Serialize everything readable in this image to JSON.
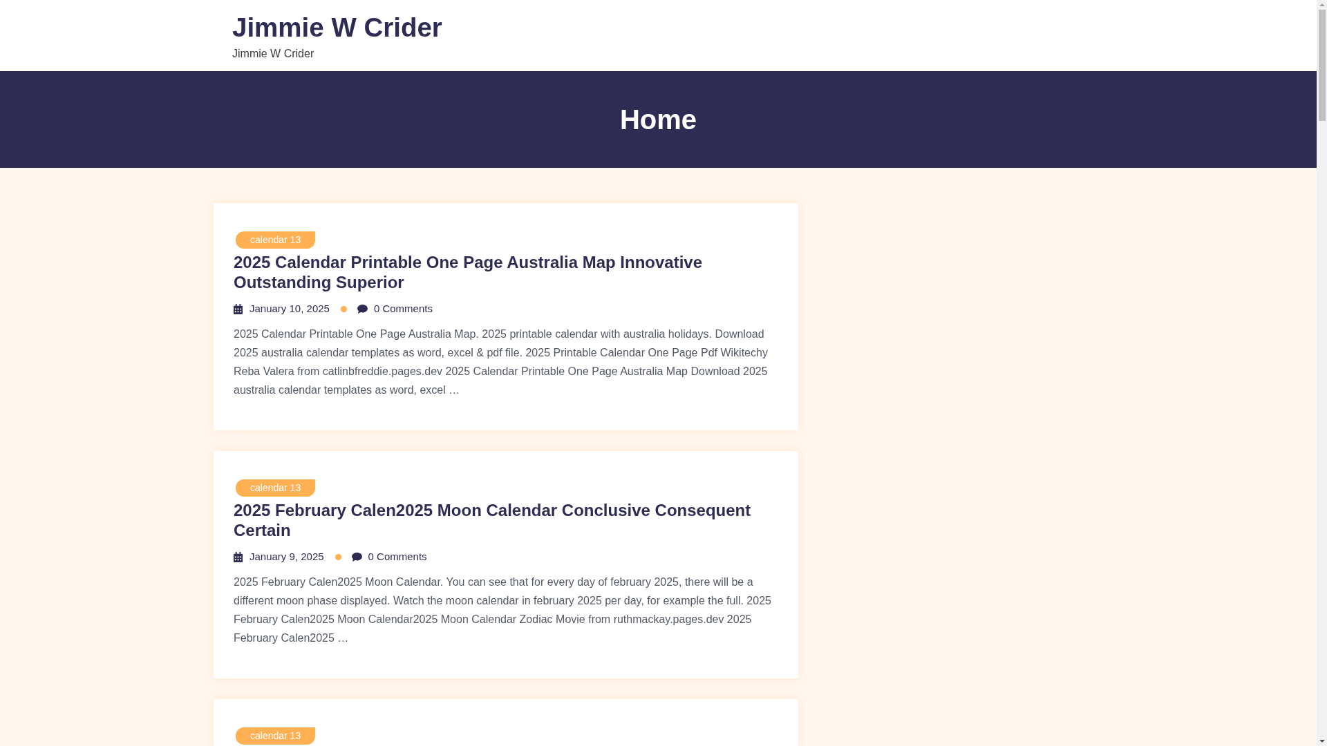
{
  "site": {
    "title": "Jimmie W Crider",
    "tagline": "Jimmie W Crider"
  },
  "page_title": "Home",
  "posts": [
    {
      "category": "calendar 13",
      "title": "2025 Calendar Printable One Page Australia Map Innovative Outstanding Superior",
      "date": "January 10, 2025",
      "comments": "0 Comments",
      "excerpt": "2025 Calendar Printable One Page Australia Map. 2025 printable calendar with australia holidays. Download 2025 australia calendar templates as word, excel & pdf file. 2025 Printable Calendar One Page Pdf Wikitechy Reba Valera from catlinbfreddie.pages.dev 2025 Calendar Printable One Page Australia Map Download 2025 australia calendar templates as word, excel …"
    },
    {
      "category": "calendar 13",
      "title": "2025 February Calen2025 Moon Calendar Conclusive Consequent Certain",
      "date": "January 9, 2025",
      "comments": "0 Comments",
      "excerpt": "2025 February Calen2025 Moon Calendar. You can see that for every day of february 2025, there will be a different moon phase displayed. Watch the moon calendar in february 2025 per day, for example the full. 2025 February Calen2025 Moon Calendar2025 Moon Calendar Zodiac Movie from ruthmackay.pages.dev 2025 February Calen2025 …"
    },
    {
      "category": "calendar 13"
    }
  ]
}
